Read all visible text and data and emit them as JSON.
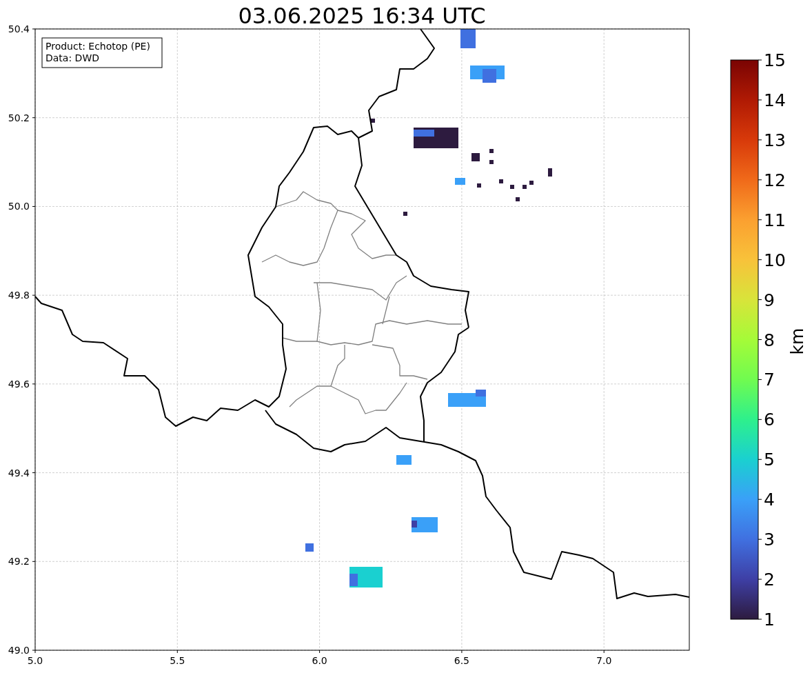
{
  "title": "03.06.2025 16:34 UTC",
  "info_box": {
    "lines": [
      "Product: Echotop (PE)",
      "Data: DWD"
    ]
  },
  "x_axis": {
    "ticks": [
      "5.0",
      "5.5",
      "6.0",
      "6.5",
      "7.0"
    ]
  },
  "y_axis": {
    "ticks": [
      "50.4",
      "50.2",
      "50.0",
      "49.8",
      "49.6",
      "49.4",
      "49.2",
      "49.0"
    ]
  },
  "colorbar": {
    "label": "km",
    "ticks": [
      "15",
      "14",
      "13",
      "12",
      "11",
      "10",
      "9",
      "8",
      "7",
      "6",
      "5",
      "4",
      "3",
      "2",
      "1"
    ]
  }
}
